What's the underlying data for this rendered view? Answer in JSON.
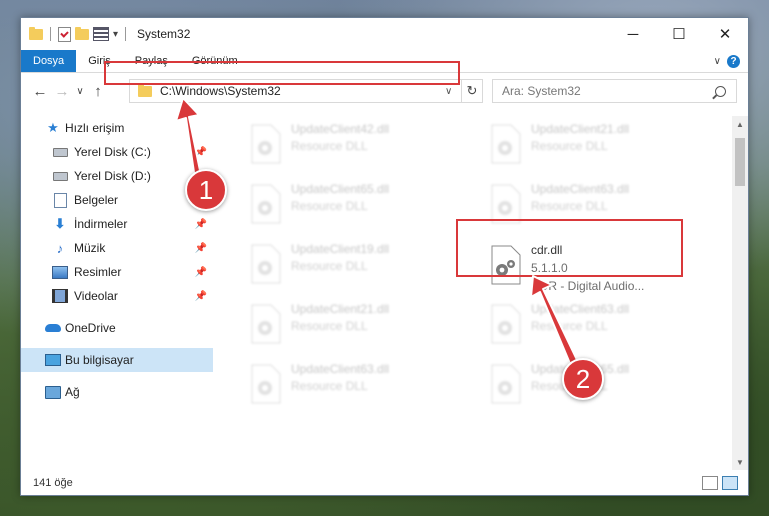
{
  "window": {
    "title": "System32",
    "controls": {
      "minimize": "─",
      "maximize": "☐",
      "close": "✕"
    }
  },
  "ribbon": {
    "tabs": [
      "Dosya",
      "Giriş",
      "Paylaş",
      "Görünüm"
    ],
    "active_tab": "Dosya"
  },
  "nav_buttons": {
    "back": "←",
    "forward": "→",
    "recent": "∨",
    "up": "↑"
  },
  "address": {
    "path": "C:\\Windows\\System32",
    "dropdown": "∨",
    "refresh": "↻"
  },
  "search": {
    "placeholder": "Ara: System32"
  },
  "sidebar": {
    "quick_access": "Hızlı erişim",
    "items": [
      {
        "label": "Yerel Disk (C:)",
        "pinned": true
      },
      {
        "label": "Yerel Disk (D:)",
        "pinned": false
      },
      {
        "label": "Belgeler",
        "pinned": true
      },
      {
        "label": "İndirmeler",
        "pinned": true
      },
      {
        "label": "Müzik",
        "pinned": true
      },
      {
        "label": "Resimler",
        "pinned": true
      },
      {
        "label": "Videolar",
        "pinned": true
      }
    ],
    "onedrive": "OneDrive",
    "this_pc": "Bu bilgisayar",
    "network": "Ağ"
  },
  "files": [
    {
      "name": "UpdateClient42.dll",
      "type": "Resource DLL"
    },
    {
      "name": "UpdateClient21.dll",
      "type": "Resource DLL"
    },
    {
      "name": "UpdateClient65.dll",
      "type": "Resource DLL"
    },
    {
      "name": "UpdateClient63.dll",
      "type": "Resource DLL"
    },
    {
      "name": "UpdateClient19.dll",
      "type": "Resource DLL"
    },
    {
      "name": "UpdateClient21.dll",
      "type": "Resource DLL"
    },
    {
      "name": "UpdateClient63.dll",
      "type": "Resource DLL"
    },
    {
      "name": "UpdateClient63.dll",
      "type": "Resource DLL"
    },
    {
      "name": "UpdateClient65.dll",
      "type": "Resource DLL"
    }
  ],
  "target_file": {
    "name": "cdr.dll",
    "version": "5.1.1.0",
    "description": "CDR - Digital Audio..."
  },
  "status": {
    "item_count": "141 öğe"
  },
  "callouts": {
    "first": "1",
    "second": "2"
  },
  "colors": {
    "accent": "#1979ca",
    "highlight": "#d9383a",
    "selection": "#cce4f7"
  }
}
